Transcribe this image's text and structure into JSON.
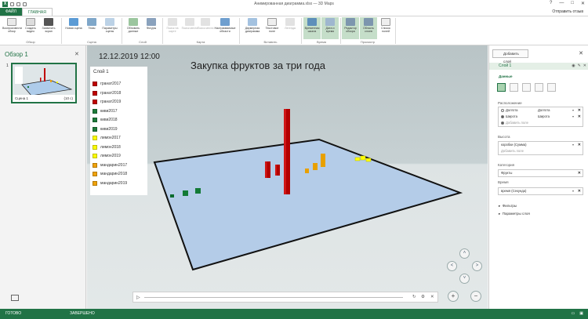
{
  "window": {
    "title": "Анимированная диаграмма.xlsx — 3D Maps",
    "controls": [
      "?",
      "—",
      "□",
      "✕"
    ]
  },
  "tabs": {
    "file": "ФАЙЛ",
    "home": "ГЛАВНАЯ"
  },
  "send_feedback": "Отправить отзыв",
  "ribbon": {
    "buttons": {
      "play_tour": "Воспроизвести обзор",
      "create_video": "Создать видео",
      "capture_screen": "Захватить экран",
      "new_scene": "Новая сцена",
      "themes": "Темы",
      "scene_options": "Параметры сцены",
      "refresh_data": "Обновить данные",
      "shapes": "Фигуры",
      "find_location": "Поиск на карте",
      "find_place": "Поиск места",
      "map_search": "Поиск места",
      "custom_regions": "Настраиваемые области",
      "2d_chart": "Двумерная диаграмма",
      "text_box": "Текстовое поле",
      "legend": "Легенда",
      "timeline": "Временная шкала",
      "date_time": "Дата и время",
      "tour_editor": "Редактор обзора",
      "layer_pane": "Область слоев",
      "field_list": "Список полей"
    },
    "groups": {
      "tour": "Обзор",
      "scene": "Сцена",
      "layer": "Слой",
      "map": "Карта",
      "insert": "Вставить",
      "time": "Время",
      "view": "Просмотр"
    }
  },
  "left_panel": {
    "title": "Обзор 1",
    "scene_number": "1",
    "scene_label": "Сцена 1",
    "scene_duration": "(10 с)"
  },
  "map": {
    "date": "12.12.2019 12:00",
    "title": "Закупка фруктов за три года",
    "legend": {
      "title": "Слой 1",
      "items": [
        {
          "label": "гранат2017",
          "color": "#c00000"
        },
        {
          "label": "гранат2018",
          "color": "#c00000"
        },
        {
          "label": "гранат2019",
          "color": "#c00000"
        },
        {
          "label": "киви2017",
          "color": "#1e7a3a"
        },
        {
          "label": "киви2018",
          "color": "#1e7a3a"
        },
        {
          "label": "киви2019",
          "color": "#1e7a3a"
        },
        {
          "label": "лимон2017",
          "color": "#ffff00"
        },
        {
          "label": "лимон2018",
          "color": "#ffff00"
        },
        {
          "label": "лимон2019",
          "color": "#ffff00"
        },
        {
          "label": "мандарин2017",
          "color": "#f0a30a"
        },
        {
          "label": "мандарин2018",
          "color": "#f0a30a"
        },
        {
          "label": "мандарин2019",
          "color": "#f0a30a"
        }
      ]
    },
    "nav": {
      "up": "˄",
      "left": "˂",
      "right": "˃",
      "down": "˅"
    },
    "zoom": {
      "in": "+",
      "out": "−"
    },
    "timeline": {
      "play": "▷",
      "refresh": "↻",
      "settings": "⚙",
      "close": "✕"
    }
  },
  "right_panel": {
    "add_layer": "Добавить слой",
    "close": "✕",
    "layer_name": "Слой 1",
    "data_section": "Данные",
    "location_label": "Расположение",
    "location_rows": [
      {
        "name": "Долгота",
        "type": "Долгота"
      },
      {
        "name": "Широта",
        "type": "Широта"
      }
    ],
    "add_field": "Добавить поле",
    "height_label": "Высота",
    "height_value": "коробки (Сумма)",
    "category_label": "Категория",
    "category_value": "Фрукты",
    "time_label": "Время",
    "time_value": "время (Секунда)",
    "filters": "Фильтры",
    "layer_options": "Параметры слоя"
  },
  "statusbar": {
    "ready": "ГОТОВО",
    "done": "ЗАВЕРШЕНО"
  }
}
